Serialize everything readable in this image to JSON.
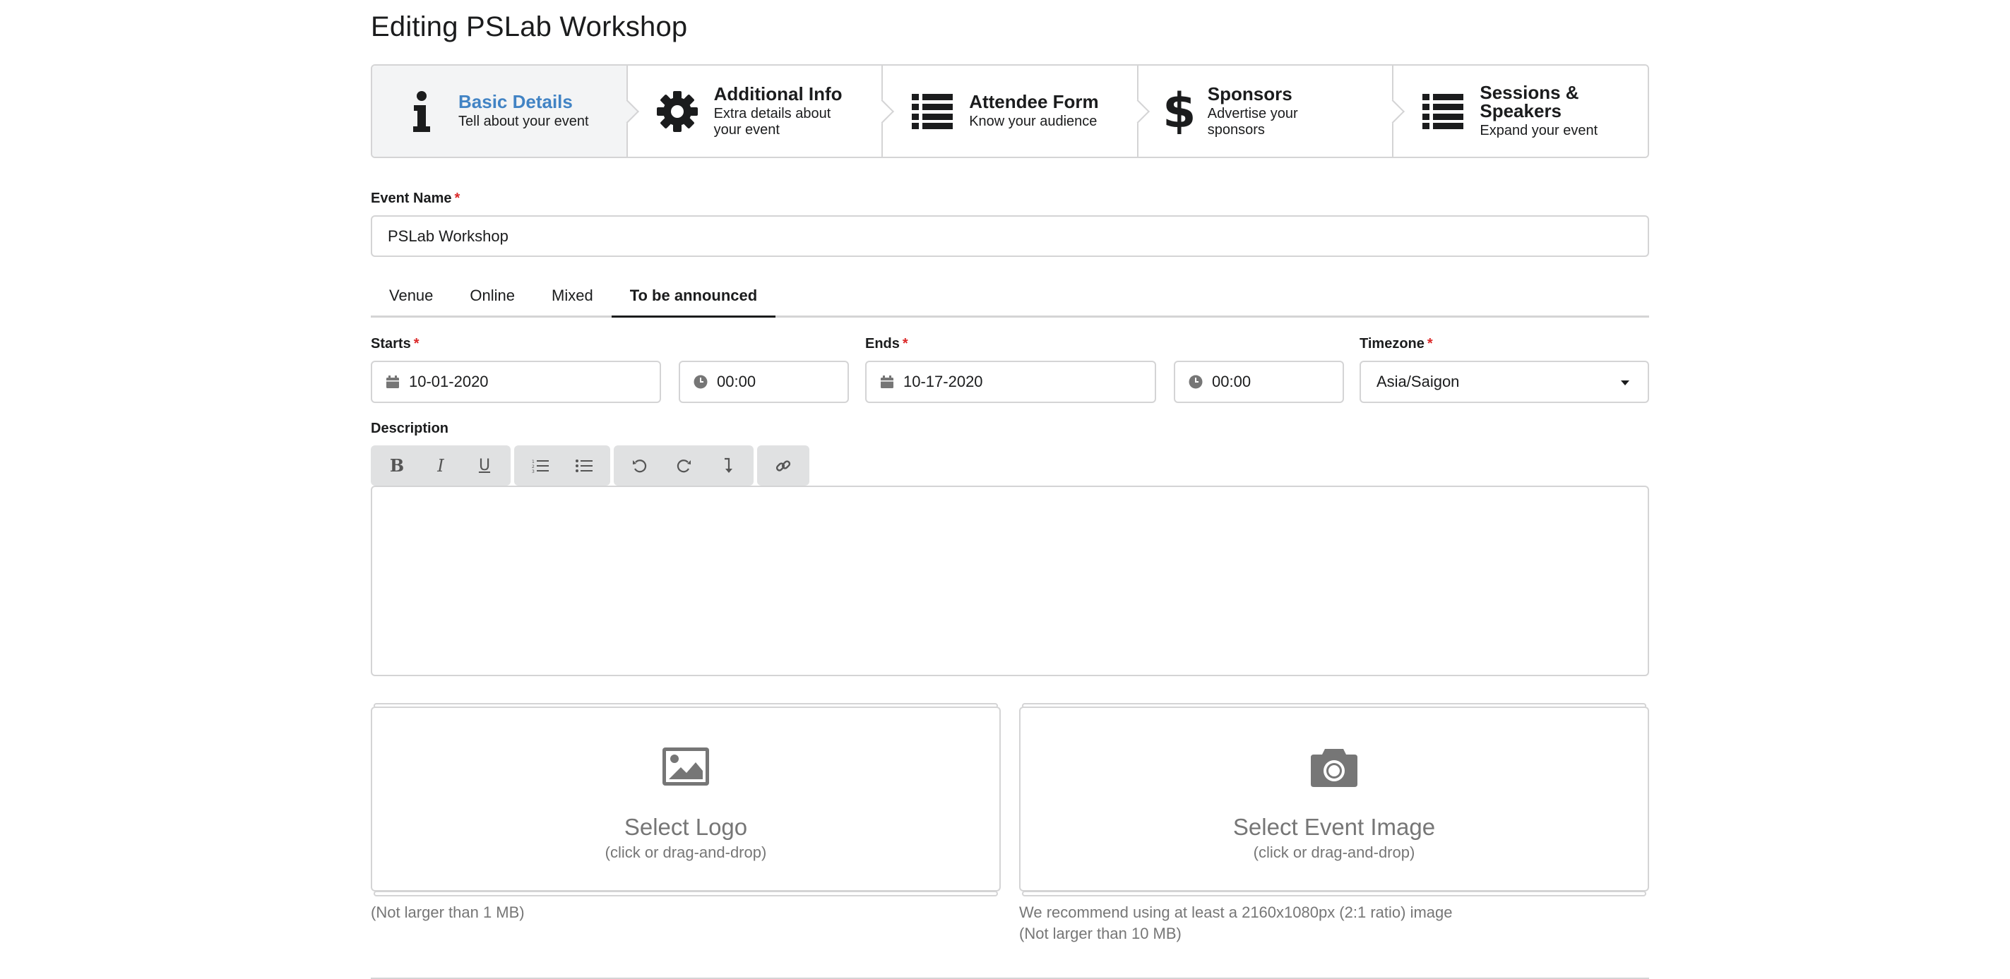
{
  "page": {
    "title": "Editing PSLab Workshop"
  },
  "steps": [
    {
      "title": "Basic Details",
      "desc": "Tell about your event",
      "icon": "info-icon",
      "active": true
    },
    {
      "title": "Additional Info",
      "desc": "Extra details about your event",
      "icon": "gear-icon",
      "active": false
    },
    {
      "title": "Attendee Form",
      "desc": "Know your audience",
      "icon": "list-icon",
      "active": false
    },
    {
      "title": "Sponsors",
      "desc": "Advertise your sponsors",
      "icon": "dollar-icon",
      "active": false
    },
    {
      "title": "Sessions & Speakers",
      "desc": "Expand your event",
      "icon": "list-icon",
      "active": false
    }
  ],
  "form": {
    "event_name_label": "Event Name",
    "event_name_value": "PSLab Workshop",
    "required_mark": "*",
    "location_tabs": [
      "Venue",
      "Online",
      "Mixed",
      "To be announced"
    ],
    "active_tab": "To be announced",
    "starts_label": "Starts",
    "starts_date": "10-01-2020",
    "starts_time": "00:00",
    "ends_label": "Ends",
    "ends_date": "10-17-2020",
    "ends_time": "00:00",
    "timezone_label": "Timezone",
    "timezone_value": "Asia/Saigon",
    "description_label": "Description",
    "editor_tools": [
      "bold-icon",
      "italic-icon",
      "underline-icon",
      "ordered-list-icon",
      "unordered-list-icon",
      "undo-icon",
      "redo-icon",
      "remove-format-icon",
      "link-icon"
    ]
  },
  "logo_upload": {
    "title": "Select Logo",
    "subtitle": "(click or drag-and-drop)",
    "hint": "(Not larger than 1 MB)"
  },
  "image_upload": {
    "title": "Select Event Image",
    "subtitle": "(click or drag-and-drop)",
    "hint_line1": "We recommend using at least a 2160x1080px (2:1 ratio) image",
    "hint_line2": "(Not larger than 10 MB)"
  },
  "colors": {
    "accent": "#4183c4",
    "required": "#db2828",
    "border": "#d4d4d5",
    "muted": "#767676"
  }
}
